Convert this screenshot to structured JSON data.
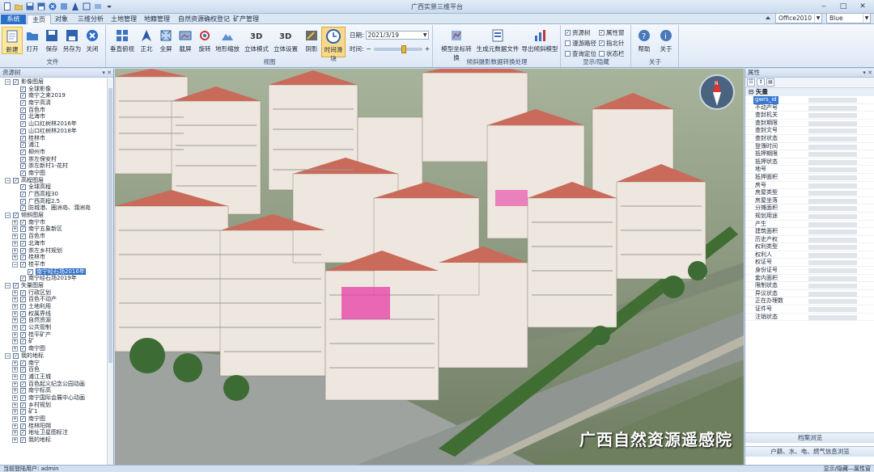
{
  "window": {
    "title": "广西实景三维平台"
  },
  "tabs": [
    {
      "label": "系统"
    },
    {
      "label": "主页"
    },
    {
      "label": "对象"
    },
    {
      "label": "三维分析"
    },
    {
      "label": "土地管理"
    },
    {
      "label": "地籍管理"
    },
    {
      "label": "自然资源确权登记"
    },
    {
      "label": "矿产管理"
    }
  ],
  "theme_combo": {
    "value": "Office2010"
  },
  "color_combo": {
    "value": "Blue"
  },
  "ribbon": {
    "file": {
      "label": "文件",
      "buttons": [
        "新建",
        "打开",
        "保存",
        "另存为",
        "关闭"
      ]
    },
    "view": {
      "label": "视图",
      "buttons": [
        "垂直俯视",
        "正北",
        "全屏",
        "截屏",
        "旋转",
        "地形缩放",
        "立体模式",
        "立体设置",
        "阴影",
        "时间滑块"
      ]
    },
    "date": {
      "label": "日期:",
      "value": "2021/3/19"
    },
    "time": {
      "label": "时间:",
      "minus": "−",
      "plus": "+"
    },
    "oblique": {
      "label": "倾斜摄影数据转换处理",
      "buttons": [
        "模型坐标转换",
        "生成元数据文件",
        "导出倾斜模型"
      ]
    },
    "display": {
      "label": "显示/隐藏",
      "checks": [
        {
          "label": "资源树",
          "checked": true
        },
        {
          "label": "漫游路径",
          "checked": false
        },
        {
          "label": "查询定位",
          "checked": false
        },
        {
          "label": "属性窗",
          "checked": true
        },
        {
          "label": "指北针",
          "checked": true
        },
        {
          "label": "状态栏",
          "checked": false
        }
      ]
    },
    "about": {
      "label": "关于",
      "buttons": [
        "帮助",
        "关于"
      ]
    }
  },
  "left_panel": {
    "title": "资源树",
    "tree": [
      {
        "level": 0,
        "label": "影像图层",
        "exp": "−"
      },
      {
        "level": 1,
        "label": "全球影像"
      },
      {
        "level": 1,
        "label": "南宁之来2019"
      },
      {
        "level": 1,
        "label": "南宁高清"
      },
      {
        "level": 1,
        "label": "百色市"
      },
      {
        "level": 1,
        "label": "北海市"
      },
      {
        "level": 1,
        "label": "山口红树林2016年"
      },
      {
        "level": 1,
        "label": "山口红树林2018年"
      },
      {
        "level": 1,
        "label": "桂林市"
      },
      {
        "level": 1,
        "label": "浦江"
      },
      {
        "level": 1,
        "label": "柳州市"
      },
      {
        "level": 1,
        "label": "崇左保安村"
      },
      {
        "level": 1,
        "label": "崇左新村1-花村"
      },
      {
        "level": 1,
        "label": "南宁图"
      },
      {
        "level": 0,
        "label": "高程图层",
        "exp": "−"
      },
      {
        "level": 1,
        "label": "全球高程"
      },
      {
        "level": 1,
        "label": "广西高程30"
      },
      {
        "level": 1,
        "label": "广西高程2.5"
      },
      {
        "level": 1,
        "label": "防城港、圈洲岛、涠洲岛"
      },
      {
        "level": 0,
        "label": "倾斜图层",
        "exp": "−"
      },
      {
        "level": 1,
        "label": "南宁市",
        "exp": "+"
      },
      {
        "level": 1,
        "label": "南宁五象新区",
        "exp": "+"
      },
      {
        "level": 1,
        "label": "百色市",
        "exp": "+"
      },
      {
        "level": 1,
        "label": "北海市",
        "exp": "+"
      },
      {
        "level": 1,
        "label": "崇左乡村规划",
        "exp": "+"
      },
      {
        "level": 1,
        "label": "桂林市",
        "exp": "+"
      },
      {
        "level": 1,
        "label": "桂平市",
        "exp": "−"
      },
      {
        "level": 2,
        "label": "南宁经石场2016年",
        "selected": true
      },
      {
        "level": 1,
        "label": "南宁经石场2019年"
      },
      {
        "level": 0,
        "label": "矢量图层",
        "exp": "−"
      },
      {
        "level": 1,
        "label": "行政区划",
        "exp": "+"
      },
      {
        "level": 1,
        "label": "百色不动产",
        "exp": "+"
      },
      {
        "level": 1,
        "label": "土地利用",
        "exp": "+"
      },
      {
        "level": 1,
        "label": "权属界线",
        "exp": "+"
      },
      {
        "level": 1,
        "label": "自然资源",
        "exp": "+"
      },
      {
        "level": 1,
        "label": "公共管制",
        "exp": "+"
      },
      {
        "level": 1,
        "label": "桂平矿产",
        "exp": "+"
      },
      {
        "level": 1,
        "label": "矿",
        "exp": "+"
      },
      {
        "level": 1,
        "label": "南宁图",
        "exp": "+"
      },
      {
        "level": 0,
        "label": "我的地标",
        "exp": "−"
      },
      {
        "level": 1,
        "label": "南宁",
        "exp": "+"
      },
      {
        "level": 1,
        "label": "百色",
        "exp": "+"
      },
      {
        "level": 1,
        "label": "浦江王城",
        "exp": "+"
      },
      {
        "level": 1,
        "label": "百色起义纪念公园动画",
        "exp": "+"
      },
      {
        "level": 1,
        "label": "南宁标高",
        "exp": "+"
      },
      {
        "level": 1,
        "label": "南宁国际会展中心动画",
        "exp": "+"
      },
      {
        "level": 1,
        "label": "乡村规划",
        "exp": "+"
      },
      {
        "level": 1,
        "label": "矿1",
        "exp": "+"
      },
      {
        "level": 1,
        "label": "南宁图",
        "exp": "+"
      },
      {
        "level": 1,
        "label": "桂林阳朔",
        "exp": "+"
      },
      {
        "level": 1,
        "label": "地址卫星图标注",
        "exp": "+"
      },
      {
        "level": 1,
        "label": "我的地标",
        "exp": "+"
      }
    ]
  },
  "map": {
    "watermark": "广西自然资源遥感院",
    "compass_letter": "N"
  },
  "right_panel": {
    "title": "属性",
    "category": "矢量",
    "fields": [
      "gwrs_id",
      "不动产号",
      "查封机关",
      "查封期限",
      "查封文号",
      "查封状态",
      "登簿时间",
      "抵押期限",
      "抵押状态",
      "地号",
      "抵押面积",
      "房号",
      "房屋类型",
      "房屋坐落",
      "分摊面积",
      "规划用途",
      "产生",
      "建筑面积",
      "历史产权",
      "权利类型",
      "权利人",
      "权证号",
      "身份证号",
      "套内面积",
      "限制状态",
      "异议状态",
      "正在办理数",
      "证件号",
      "注销状态"
    ],
    "btn1": "档案浏览",
    "btn2": "户籍、水、电、燃气信息浏览"
  },
  "status": {
    "left": "当前登陆用户: admin",
    "right": "显示/隐藏—属性窗"
  }
}
